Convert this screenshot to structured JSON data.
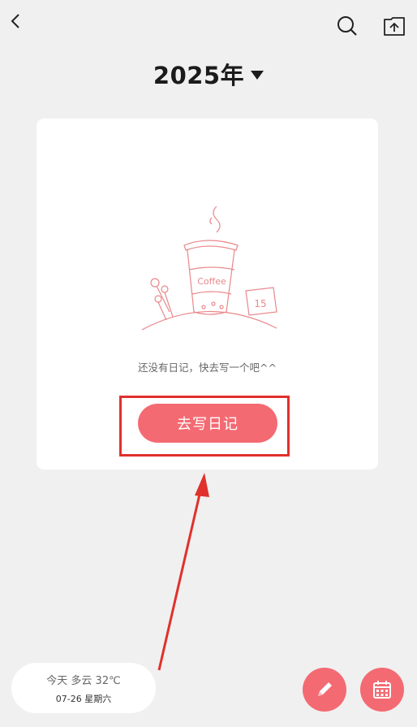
{
  "header": {
    "back_icon": "chevron-left-icon",
    "search_icon": "search-icon",
    "upload_icon": "cloud-upload-icon",
    "year_label": "2025年",
    "year_caret_icon": "triangle-down-icon"
  },
  "card": {
    "illustration_text": "Coffee",
    "illustration_date": "15",
    "empty_message": "还没有日记，快去写一个吧^^",
    "write_button_label": "去写日记"
  },
  "weather": {
    "line1": "今天  多云 32℃",
    "line2": "07-26 星期六"
  },
  "fabs": {
    "write_icon": "pencil-icon",
    "calendar_icon": "calendar-icon"
  },
  "colors": {
    "accent": "#f46a72",
    "highlight": "#e0312c",
    "background": "#f0f0f0"
  }
}
